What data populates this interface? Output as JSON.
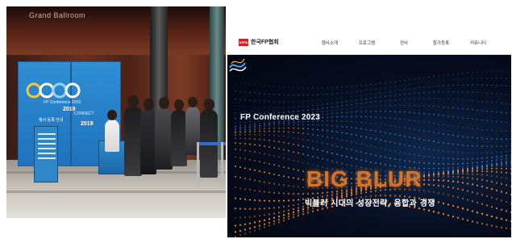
{
  "photo": {
    "ceiling_text": "Grand Ballroom",
    "booth": {
      "caption": "FP Conference 2019",
      "year": "2019",
      "side_text": "CONNECT",
      "side_year": "2019",
      "notice": "행사 등록 안내"
    }
  },
  "site": {
    "logo": {
      "mark": "KFPA",
      "name": "한국FP협회"
    },
    "nav": {
      "items": [
        "행사소개",
        "프로그램",
        "연사",
        "참가등록",
        "커뮤니티"
      ]
    },
    "hero": {
      "title": "FP Conference 2023",
      "big_title": "BIG BLUR",
      "subtitle": "빅블러 시대의 성장전략, 융합과 경쟁"
    },
    "colors": {
      "accent_orange": "#d2732e",
      "brand_red": "#d42128",
      "dot_blue": "#3aa0ff",
      "dot_orange": "#ff8a2a"
    }
  }
}
